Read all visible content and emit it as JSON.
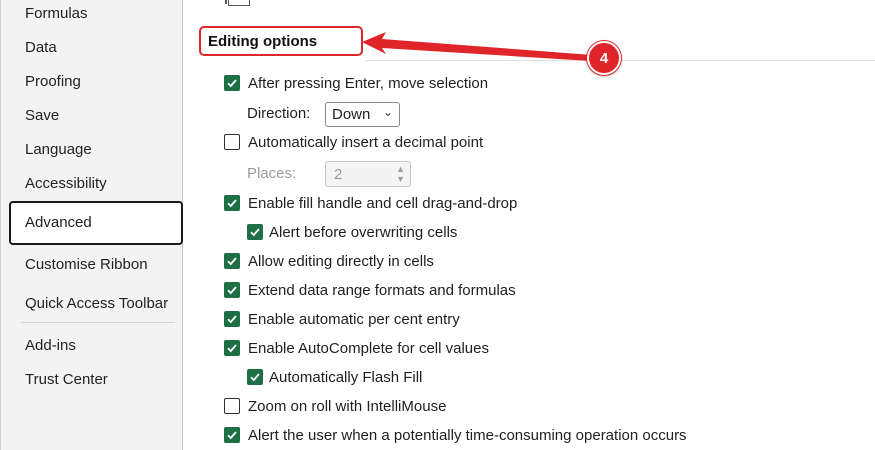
{
  "sidebar": {
    "items": [
      {
        "label": "Formulas"
      },
      {
        "label": "Data"
      },
      {
        "label": "Proofing"
      },
      {
        "label": "Save"
      },
      {
        "label": "Language"
      },
      {
        "label": "Accessibility"
      },
      {
        "label": "Advanced"
      },
      {
        "label": "Customise Ribbon"
      },
      {
        "label": "Quick Access Toolbar"
      },
      {
        "label": "Add-ins"
      },
      {
        "label": "Trust Center"
      }
    ],
    "selected": "Advanced"
  },
  "section": {
    "title": "Editing options"
  },
  "callout": {
    "number": "4",
    "color": "#e0252a"
  },
  "options": {
    "after_enter": {
      "label": "After pressing Enter, move selection",
      "checked": true
    },
    "direction": {
      "label": "Direction:",
      "value": "Down"
    },
    "decimal_point": {
      "label": "Automatically insert a decimal point",
      "checked": false
    },
    "places": {
      "label": "Places:",
      "value": "2"
    },
    "fill_handle": {
      "label": "Enable fill handle and cell drag-and-drop",
      "checked": true
    },
    "alert_overwrite": {
      "label": "Alert before overwriting cells",
      "checked": true
    },
    "edit_in_cells": {
      "label": "Allow editing directly in cells",
      "checked": true
    },
    "extend_formats": {
      "label": "Extend data range formats and formulas",
      "checked": true
    },
    "percent_entry": {
      "label": "Enable automatic per cent entry",
      "checked": true
    },
    "autocomplete": {
      "label": "Enable AutoComplete for cell values",
      "checked": true
    },
    "flash_fill": {
      "label": "Automatically Flash Fill",
      "checked": true
    },
    "zoom_roll": {
      "label": "Zoom on roll with IntelliMouse",
      "checked": false
    },
    "alert_slow": {
      "label": "Alert the user when a potentially time-consuming operation occurs",
      "checked": true
    }
  },
  "colors": {
    "checkbox_on": "#1e6f45",
    "highlight": "#e0252a"
  }
}
